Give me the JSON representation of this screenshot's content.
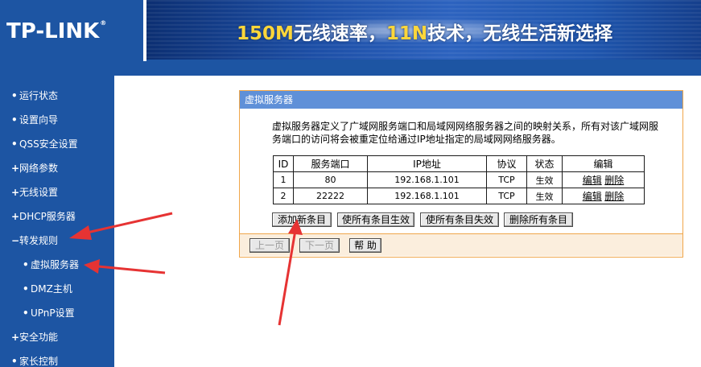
{
  "header": {
    "logo": "TP-LINK",
    "logo_reg": "®",
    "banner_part1": "150M",
    "banner_part2": "无线速率，",
    "banner_part3": "11N",
    "banner_part4": "技术，无线生活新选择"
  },
  "sidebar": {
    "items": [
      {
        "label": "运行状态",
        "bullet": "•"
      },
      {
        "label": "设置向导",
        "bullet": "•"
      },
      {
        "label": "QSS安全设置",
        "bullet": "•"
      },
      {
        "label": "网络参数",
        "bullet": "+"
      },
      {
        "label": "无线设置",
        "bullet": "+"
      },
      {
        "label": "DHCP服务器",
        "bullet": "+"
      },
      {
        "label": "转发规则",
        "bullet": "−"
      },
      {
        "label": "虚拟服务器",
        "bullet": "•"
      },
      {
        "label": "DMZ主机",
        "bullet": "•"
      },
      {
        "label": "UPnP设置",
        "bullet": "•"
      },
      {
        "label": "安全功能",
        "bullet": "+"
      },
      {
        "label": "家长控制",
        "bullet": "•"
      }
    ]
  },
  "panel": {
    "title": "虚拟服务器",
    "description": "虚拟服务器定义了广域网服务端口和局域网网络服务器之间的映射关系，所有对该广域网服务端口的访问将会被重定位给通过IP地址指定的局域网网络服务器。",
    "table": {
      "headers": [
        "ID",
        "服务端口",
        "IP地址",
        "协议",
        "状态",
        "编辑"
      ],
      "rows": [
        {
          "id": "1",
          "port": "80",
          "ip": "192.168.1.101",
          "protocol": "TCP",
          "status": "生效",
          "edit": "编辑",
          "delete": "删除"
        },
        {
          "id": "2",
          "port": "22222",
          "ip": "192.168.1.101",
          "protocol": "TCP",
          "status": "生效",
          "edit": "编辑",
          "delete": "删除"
        }
      ]
    },
    "buttons": {
      "add": "添加新条目",
      "enable_all": "使所有条目生效",
      "disable_all": "使所有条目失效",
      "delete_all": "删除所有条目"
    },
    "footer": {
      "prev": "上一页",
      "next": "下一页",
      "help": "帮 助"
    }
  },
  "colors": {
    "brand_blue": "#1d55a3",
    "panel_title": "#5f90d8",
    "panel_border": "#f0a64a",
    "arrow_red": "#e63333",
    "banner_highlight": "#fcd63a"
  }
}
